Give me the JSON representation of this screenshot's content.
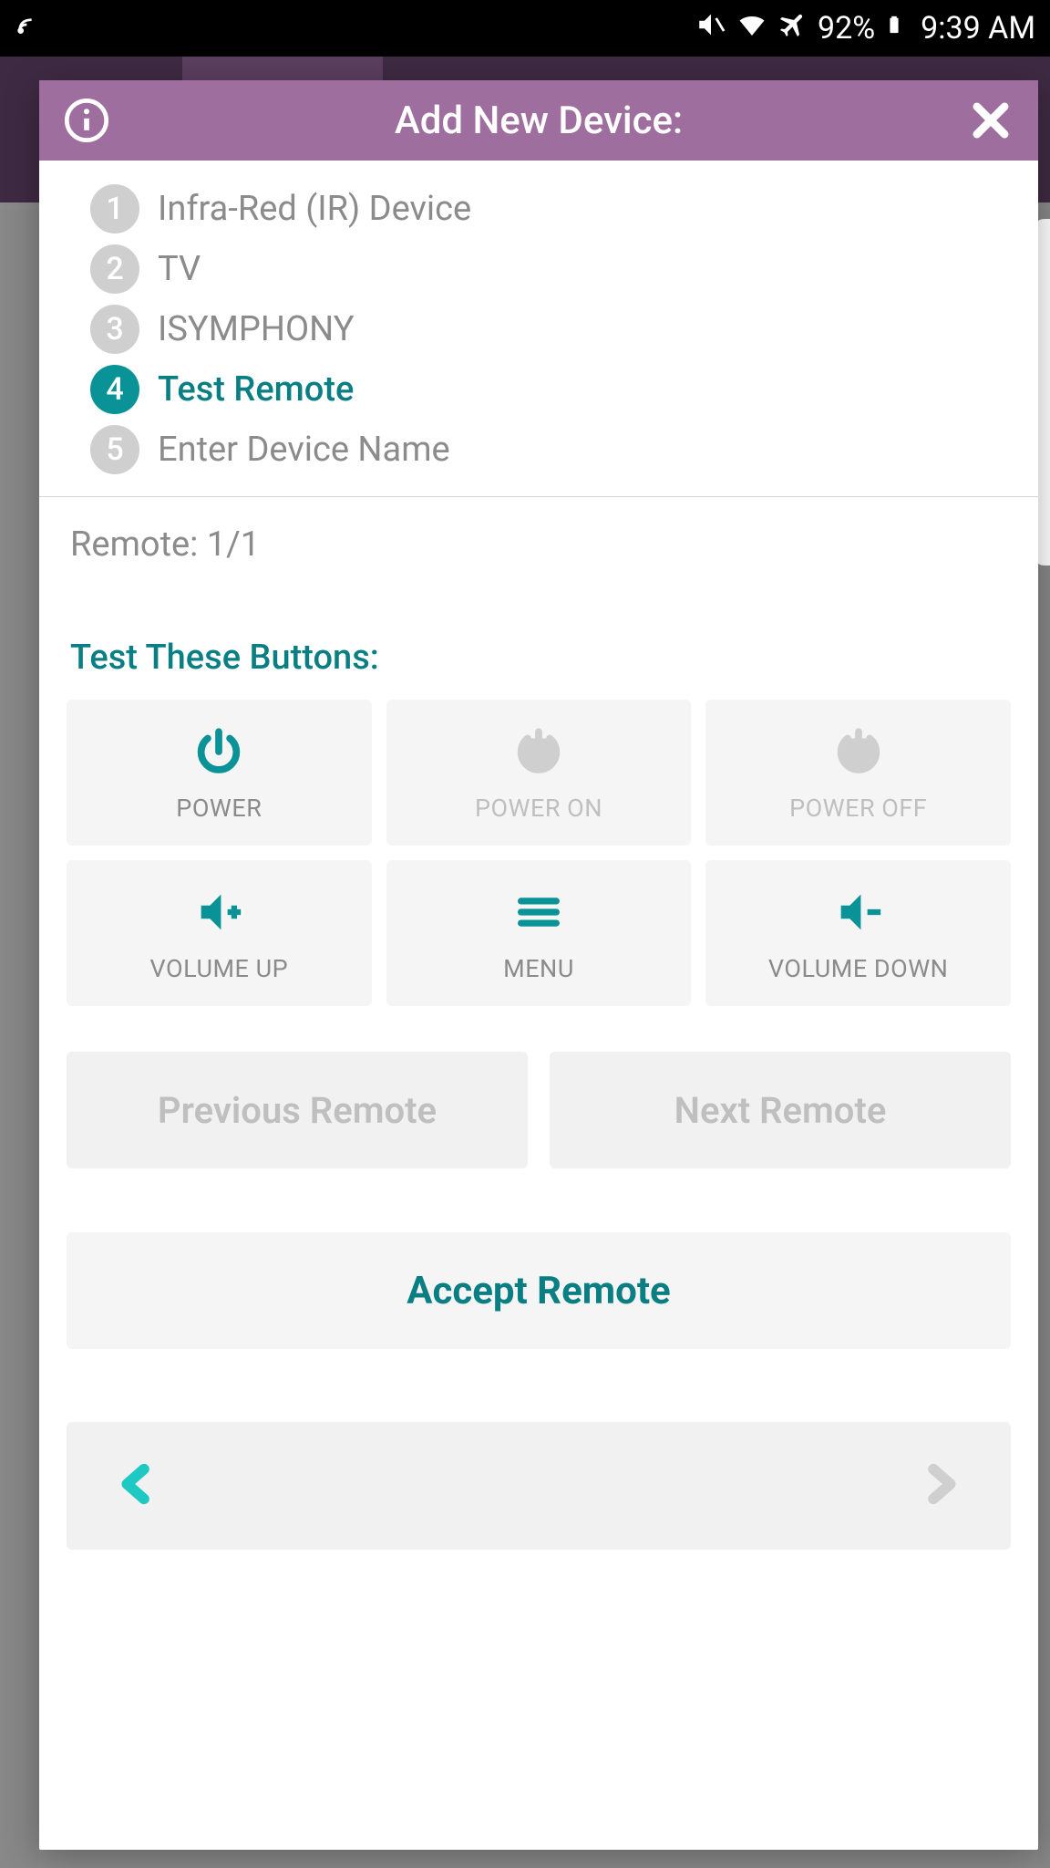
{
  "status": {
    "battery": "92%",
    "time": "9:39 AM"
  },
  "modal": {
    "title": "Add New Device:"
  },
  "steps": [
    {
      "num": "1",
      "label": "Infra-Red (IR) Device",
      "active": false
    },
    {
      "num": "2",
      "label": "TV",
      "active": false
    },
    {
      "num": "3",
      "label": "ISYMPHONY",
      "active": false
    },
    {
      "num": "4",
      "label": "Test Remote",
      "active": true
    },
    {
      "num": "5",
      "label": "Enter Device Name",
      "active": false
    }
  ],
  "remote": {
    "count_label": "Remote: 1/1",
    "test_heading": "Test These Buttons:"
  },
  "buttons": {
    "power": "POWER",
    "power_on": "POWER ON",
    "power_off": "POWER OFF",
    "vol_up": "VOLUME UP",
    "menu": "MENU",
    "vol_down": "VOLUME DOWN"
  },
  "nav": {
    "prev": "Previous Remote",
    "next": "Next Remote",
    "accept": "Accept Remote"
  }
}
